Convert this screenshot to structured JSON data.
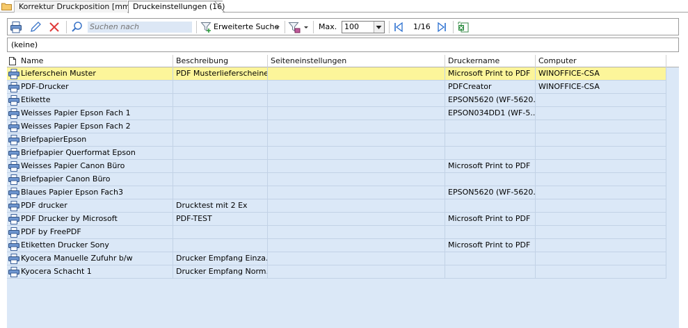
{
  "tabs": [
    {
      "label": "Korrektur Druckposition [mm]"
    },
    {
      "label": "Druckeinstellungen (16)"
    }
  ],
  "toolbar": {
    "search_placeholder": "Suchen nach",
    "advanced_search_label": "Erweiterte Suche",
    "max_label": "Max.",
    "max_value": "100",
    "pager_text": "1/16"
  },
  "filter_text": "(keine)",
  "columns": [
    "Name",
    "Beschreibung",
    "Seiteneinstellungen",
    "Druckername",
    "Computer"
  ],
  "rows": [
    {
      "name": "Lieferschein Muster",
      "beschreibung": "PDF Musterlieferscheine",
      "seite": "",
      "drucker": "Microsoft Print to PDF",
      "computer": "WINOFFICE-CSA"
    },
    {
      "name": "PDF-Drucker",
      "beschreibung": "",
      "seite": "",
      "drucker": "PDFCreator",
      "computer": "WINOFFICE-CSA"
    },
    {
      "name": "Etikette",
      "beschreibung": "",
      "seite": "",
      "drucker": "EPSON5620  (WF-5620...",
      "computer": ""
    },
    {
      "name": "Weisses Papier Epson Fach 1",
      "beschreibung": "",
      "seite": "",
      "drucker": "EPSON034DD1 (WF-5...",
      "computer": ""
    },
    {
      "name": "Weisses Papier Epson Fach 2",
      "beschreibung": "",
      "seite": "",
      "drucker": "",
      "computer": ""
    },
    {
      "name": "BriefpapierEpson",
      "beschreibung": "",
      "seite": "",
      "drucker": "",
      "computer": ""
    },
    {
      "name": "Briefpapier Querformat Epson",
      "beschreibung": "",
      "seite": "",
      "drucker": "",
      "computer": ""
    },
    {
      "name": "Weisses Papier Canon Büro",
      "beschreibung": "",
      "seite": "",
      "drucker": "Microsoft Print to PDF",
      "computer": ""
    },
    {
      "name": "Briefpapier Canon Büro",
      "beschreibung": "",
      "seite": "",
      "drucker": "",
      "computer": ""
    },
    {
      "name": "Blaues Papier Epson Fach3",
      "beschreibung": "",
      "seite": "",
      "drucker": "EPSON5620  (WF-5620...",
      "computer": ""
    },
    {
      "name": "PDF drucker",
      "beschreibung": "Drucktest mit 2 Ex",
      "seite": "",
      "drucker": "",
      "computer": ""
    },
    {
      "name": "PDF Drucker by Microsoft",
      "beschreibung": "PDF-TEST",
      "seite": "",
      "drucker": "Microsoft Print to PDF",
      "computer": ""
    },
    {
      "name": "PDF by FreePDF",
      "beschreibung": "",
      "seite": "",
      "drucker": "",
      "computer": ""
    },
    {
      "name": "Etiketten Drucker Sony",
      "beschreibung": "",
      "seite": "",
      "drucker": "Microsoft Print to PDF",
      "computer": ""
    },
    {
      "name": "Kyocera Manuelle Zufuhr b/w",
      "beschreibung": "Drucker Empfang Einza...",
      "seite": "",
      "drucker": "",
      "computer": ""
    },
    {
      "name": "Kyocera Schacht 1",
      "beschreibung": "Drucker Empfang Norm...",
      "seite": "",
      "drucker": "",
      "computer": ""
    }
  ],
  "selected_row": 0,
  "colors": {
    "selected_row": "#fcf59a",
    "grid_bg": "#dbe8f7",
    "accent_blue": "#2a6fd0"
  },
  "icons": [
    "folder-icon",
    "print-icon",
    "edit-icon",
    "delete-icon",
    "search-icon",
    "filter-icon",
    "filter-clear-icon",
    "first-page-icon",
    "last-page-icon",
    "excel-export-icon",
    "new-document-icon",
    "printer-row-icon"
  ]
}
